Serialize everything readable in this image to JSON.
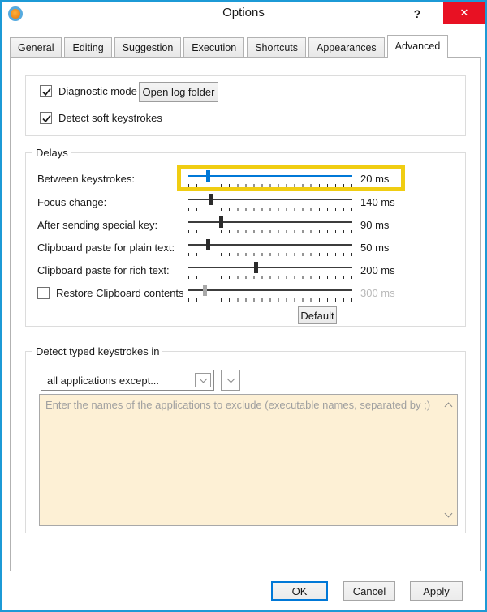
{
  "window": {
    "title": "Options",
    "help_label": "?",
    "close_label": "✕"
  },
  "tabs": [
    {
      "label": "General"
    },
    {
      "label": "Editing"
    },
    {
      "label": "Suggestion"
    },
    {
      "label": "Execution"
    },
    {
      "label": "Shortcuts"
    },
    {
      "label": "Appearances"
    },
    {
      "label": "Advanced",
      "active": true
    }
  ],
  "general_group": {
    "diagnostic": {
      "label": "Diagnostic mode",
      "checked": true
    },
    "open_log_button_label": "Open log folder",
    "soft_keystrokes": {
      "label": "Detect soft keystrokes",
      "checked": true
    }
  },
  "delays_group": {
    "title": "Delays",
    "sliders": [
      {
        "label": "Between keystrokes:",
        "value": "20 ms",
        "fraction": 0.12,
        "accent": true,
        "highlighted": true
      },
      {
        "label": "Focus change:",
        "value": "140 ms",
        "fraction": 0.14
      },
      {
        "label": "After sending special key:",
        "value": "90 ms",
        "fraction": 0.2
      },
      {
        "label": "Clipboard paste for plain text:",
        "value": "50 ms",
        "fraction": 0.12
      },
      {
        "label": "Clipboard paste for rich text:",
        "value": "200 ms",
        "fraction": 0.41
      },
      {
        "label": "Restore Clipboard contents",
        "value": "300 ms",
        "fraction": 0.1,
        "disabled": true,
        "has_checkbox": true,
        "checked": false
      }
    ],
    "default_button_label": "Default"
  },
  "detect_group": {
    "title": "Detect typed keystrokes in",
    "combo_value": "all applications except...",
    "textarea_value": "",
    "textarea_placeholder": "Enter the names of the applications to exclude (executable names, separated by ;)"
  },
  "footer": {
    "ok_label": "OK",
    "cancel_label": "Cancel",
    "apply_label": "Apply"
  },
  "colors": {
    "accent_blue": "#0078d7",
    "highlight_yellow": "#f0cd12",
    "close_red": "#e81123",
    "window_border": "#1c9ad6",
    "textarea_bg": "#fdf0d5"
  }
}
